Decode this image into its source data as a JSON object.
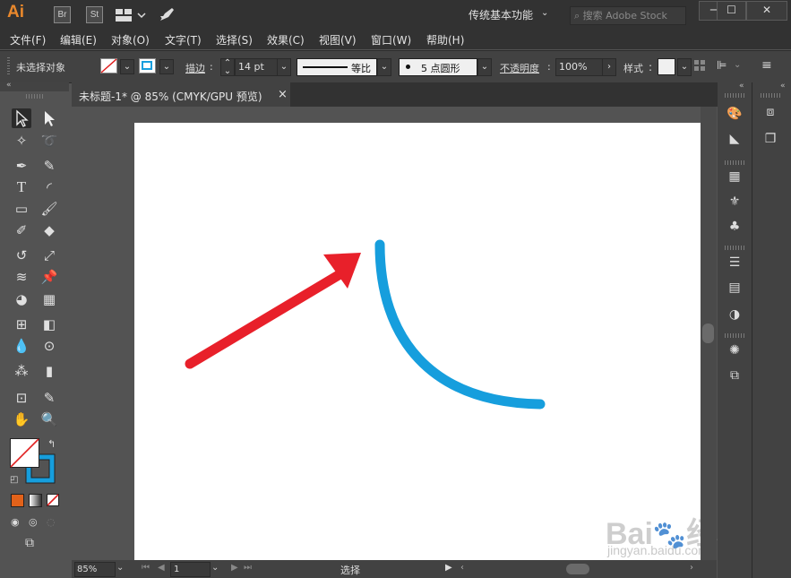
{
  "titlebar": {
    "app_logo": "Ai",
    "bridge": "Br",
    "stock": "St",
    "workspace": "传统基本功能",
    "search_placeholder": "搜索 Adobe Stock",
    "min": "─",
    "max": "☐",
    "close": "✕"
  },
  "menu": [
    "文件(F)",
    "编辑(E)",
    "对象(O)",
    "文字(T)",
    "选择(S)",
    "效果(C)",
    "视图(V)",
    "窗口(W)",
    "帮助(H)"
  ],
  "control": {
    "selection": "未选择对象",
    "stroke_label": "描边",
    "stroke_weight": "14 pt",
    "profile": "等比",
    "brush": "5 点圆形",
    "opacity_label": "不透明度",
    "opacity": "100%",
    "style_label": "样式"
  },
  "document": {
    "tab": "未标题-1* @ 85% (CMYK/GPU 预览)",
    "tab_close": "×"
  },
  "status": {
    "zoom": "85%",
    "page": "1",
    "tool": "选择"
  },
  "artwork": {
    "arrow_color": "#e8202a",
    "curve_color": "#169edd"
  },
  "watermark": {
    "brand": "Bai",
    "brand_cn": "经验",
    "url": "jingyan.baidu.com"
  }
}
